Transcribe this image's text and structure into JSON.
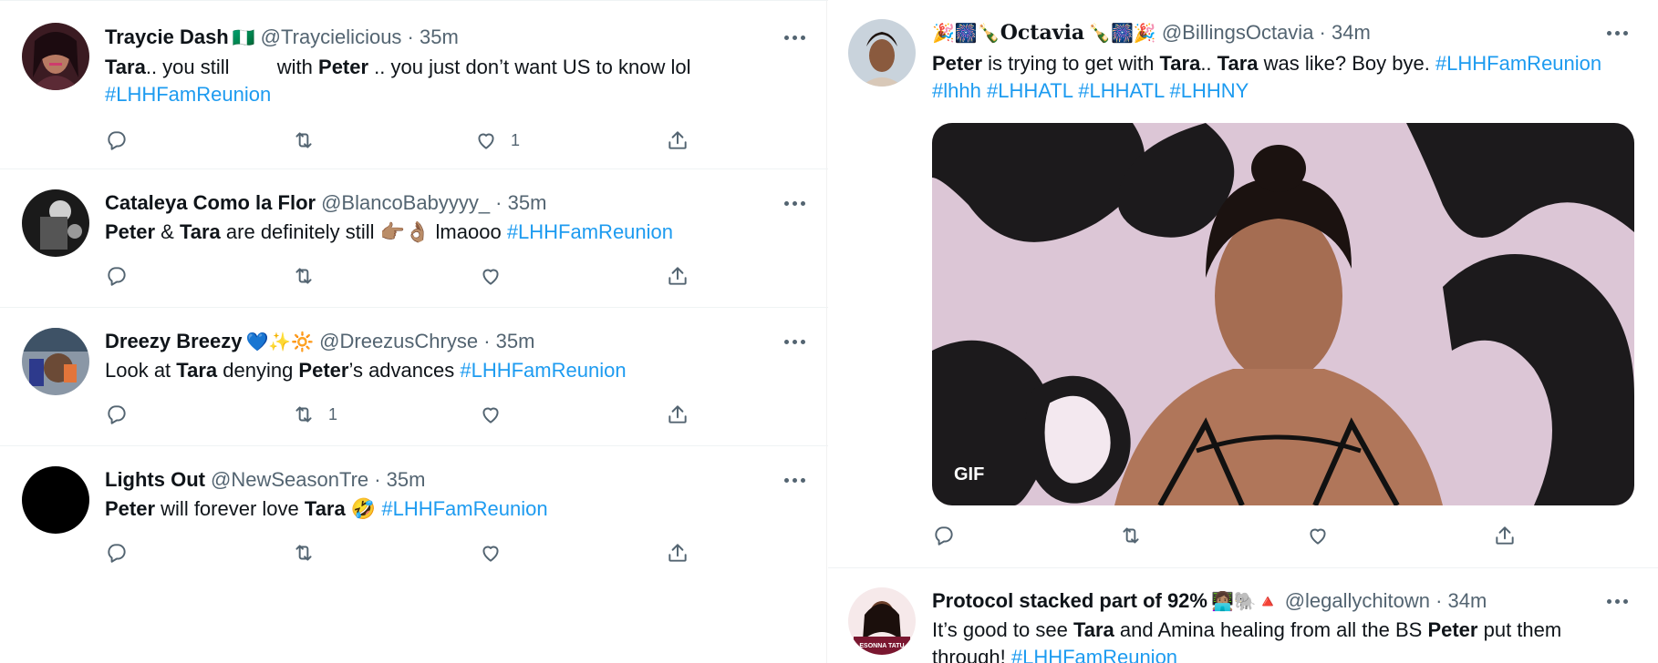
{
  "colors": {
    "link": "#1d9bf0",
    "handle": "#536471",
    "text": "#0f1419"
  },
  "tweets_left": [
    {
      "name": "Traycie Dash",
      "name_emoji": "🇳🇬",
      "handle_time": "@Traycielicious · 35m",
      "text_pre": ".. you still ",
      "text_mid": " with ",
      "text_post": " .. you just don’t want US to know lol",
      "bold_1": "Tara",
      "bold_2": "Peter",
      "hashtag": "#LHHFamReunion",
      "like_count": "1"
    },
    {
      "name": "Cataleya Como la Flor",
      "handle_time": "@BlancoBabyyyy_ · 35m",
      "bold_1": "Peter",
      "text_amp": " & ",
      "bold_2": "Tara",
      "text_post": " are definitely still 👉🏽👌🏽 lmaooo ",
      "hashtag": "#LHHFamReunion"
    },
    {
      "name": "Dreezy Breezy",
      "name_emoji": "💙✨🔆",
      "handle_time": "@DreezusChryse · 35m",
      "text_pre": "Look at ",
      "bold_1": "Tara",
      "text_mid": " denying ",
      "bold_2": "Peter",
      "text_post": "’s advances  ",
      "hashtag": "#LHHFamReunion",
      "retweet_count": "1"
    },
    {
      "name": "Lights Out",
      "handle_time": "@NewSeasonTre · 35m",
      "bold_1": "Peter",
      "text_mid": " will forever love ",
      "bold_2": "Tara",
      "text_post": " 🤣 ",
      "hashtag": "#LHHFamReunion"
    }
  ],
  "tweet_right_1": {
    "name_prefix": "🎉🎆🍾",
    "name": "Octavia",
    "name_suffix": "🍾🎆🎉",
    "handle_time": "@BillingsOctavia · 34m",
    "bold_1": "Peter",
    "text_1": " is trying to get with ",
    "bold_2": "Tara",
    "text_2": ".. ",
    "bold_3": "Tara",
    "text_3": " was like? Boy bye.  ",
    "hashtag_1": "#LHHFamReunion",
    "hashtag_2": "#lhhh",
    "hashtag_3": "#LHHATL",
    "hashtag_4": "#LHHATL",
    "hashtag_5": "#LHHNY",
    "gif_label": "GIF"
  },
  "tweet_right_2": {
    "name": "Protocol stacked part of 92%",
    "name_emoji": "👩🏽‍💻🐘🔺",
    "handle_time": "@legallychitown · 34m",
    "text_1": "It’s good to see ",
    "bold_1": "Tara",
    "text_2": " and Amina healing from all the BS ",
    "bold_2": "Peter",
    "text_3": " put them through!  ",
    "hashtag": "#LHHFamReunion",
    "avatar_text": "ESONNA TATU"
  },
  "icons": [
    "reply-icon",
    "retweet-icon",
    "like-icon",
    "share-icon",
    "more-icon"
  ]
}
